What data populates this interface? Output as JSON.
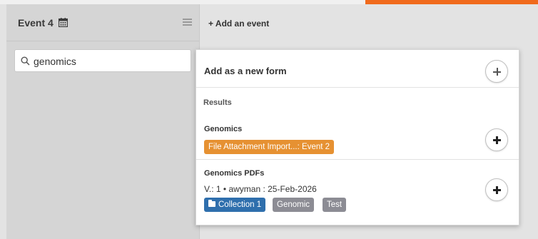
{
  "left_panel": {
    "title": "Event 4",
    "search": {
      "value": "genomics",
      "placeholder": ""
    }
  },
  "toolbar": {
    "add_event_label": "+ Add an event"
  },
  "popup": {
    "header": "Add as a new form",
    "results_label": "Results",
    "results": [
      {
        "title": "Genomics",
        "badge": "File Attachment Import...: Event 2"
      },
      {
        "title": "Genomics PDFs",
        "meta": "V.: 1  •  awyman :  25-Feb-2026",
        "tags": [
          "Collection 1",
          "Genomic",
          "Test"
        ]
      }
    ]
  },
  "colors": {
    "accent": "#f06a1c",
    "badge_orange": "#e69132",
    "badge_blue": "#2f6fad",
    "badge_gray": "#8c8c94"
  },
  "icons": {
    "calendar": "calendar-icon",
    "menu": "hamburger-menu-icon",
    "search": "search-icon",
    "add": "plus-circle-icon",
    "folder": "folder-icon"
  }
}
